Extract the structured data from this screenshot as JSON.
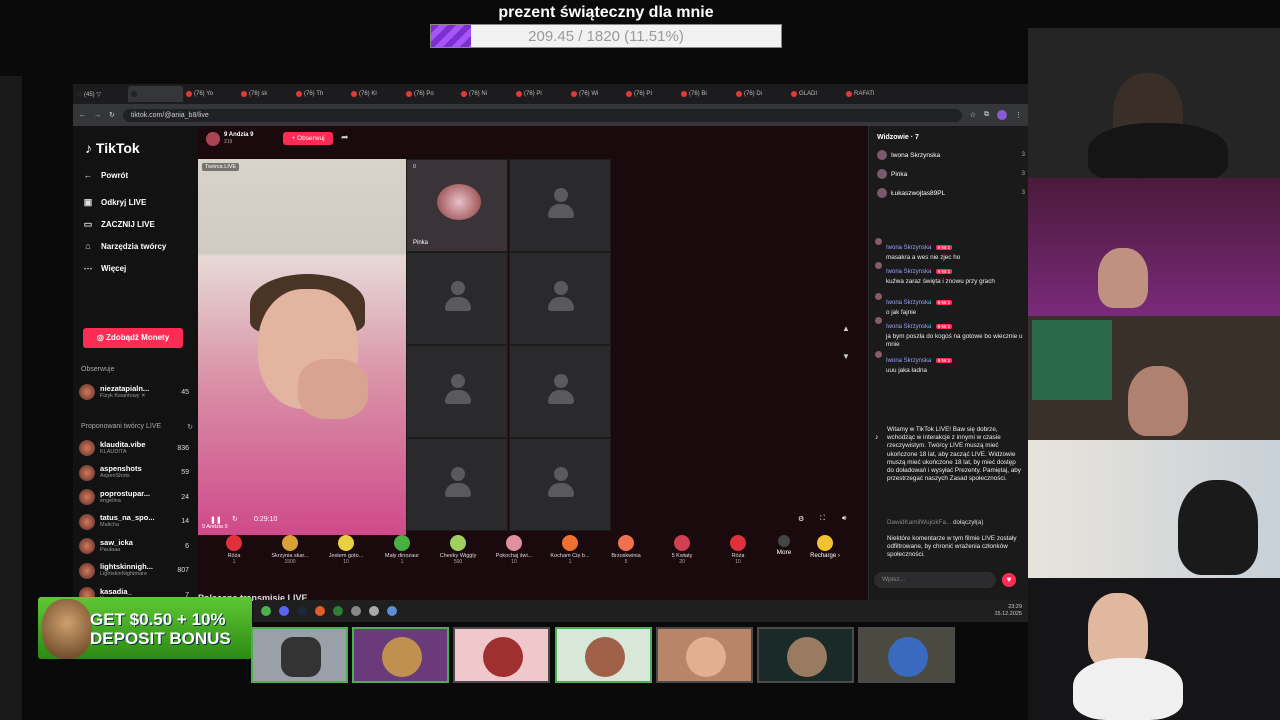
{
  "goal": {
    "title": "prezent świąteczny dla mnie",
    "progress_text": "209.45 / 1820 (11.51%)",
    "progress_fraction": 0.1151
  },
  "browser": {
    "tabs": [
      "(45) ▽",
      "",
      "(76) Yo",
      "(76) sk",
      "(76) Th",
      "(76) Kl",
      "(76) Po",
      "(76) Ni",
      "(76) Pl",
      "(76) Wi",
      "(76) PI",
      "(76) Bi",
      "(76) Di",
      "GLADI",
      "RAFATI"
    ],
    "url": "tiktok.com/@ania_b8/live"
  },
  "tiktok": {
    "logo": "TikTok",
    "nav": [
      "Powrót",
      "Odkryj LIVE",
      "ZACZNIJ LIVE",
      "Narzędzia twórcy",
      "Więcej"
    ],
    "coins_button": "Zdobądź Monety",
    "following_title": "Obserwuje",
    "following": [
      {
        "name": "niezatapialn...",
        "sub": "Fizyk Kwantowy ✕",
        "count": "45"
      }
    ],
    "suggested_title": "Proponowani twórcy LIVE",
    "suggested": [
      {
        "name": "klaudita.vibe",
        "sub": "KLAUDITA",
        "count": "836"
      },
      {
        "name": "aspenshots",
        "sub": "AspenShots",
        "count": "59"
      },
      {
        "name": "poprostupar...",
        "sub": "engelina",
        "count": "24"
      },
      {
        "name": "tatus_na_spo...",
        "sub": "Malicha",
        "count": "14"
      },
      {
        "name": "saw_icka",
        "sub": "Paulaaa",
        "count": "6"
      },
      {
        "name": "lightskinnigh...",
        "sub": "LightskinNightmare",
        "count": "807"
      },
      {
        "name": "kasadia_",
        "sub": "Kasadia",
        "count": "7"
      },
      {
        "name": "plinkmia",
        "sub": "Mia",
        "count": "357"
      },
      {
        "name": "strzalaxgami...",
        "sub": "",
        "count": ""
      }
    ],
    "host": {
      "name": "9 Andzia 9",
      "views": "219",
      "follow_label": "+ Obserwuj"
    },
    "cam_label": "Twórca LIVE",
    "cam_bottom": "9 Andzia 9",
    "guest": {
      "name": "Pinka",
      "count": "0"
    },
    "timer": "0:29:10",
    "gifts": [
      {
        "name": "Róża",
        "price": "1",
        "color": "#e0303a"
      },
      {
        "name": "Skrzynia skar...",
        "price": "1500",
        "color": "#d9a03a"
      },
      {
        "name": "Jestem goto...",
        "price": "10",
        "color": "#e8d040"
      },
      {
        "name": "Mały dinozaur",
        "price": "1",
        "color": "#48b040"
      },
      {
        "name": "Cheeky Wiggly",
        "price": "500",
        "color": "#a0d060"
      },
      {
        "name": "Pokochaj świ...",
        "price": "10",
        "color": "#e090a0"
      },
      {
        "name": "Kocham Cię b...",
        "price": "1",
        "color": "#f07030"
      },
      {
        "name": "Brzoskwinia",
        "price": "5",
        "color": "#f07050"
      },
      {
        "name": "5 Kwiaty",
        "price": "20",
        "color": "#d04050"
      },
      {
        "name": "Róża",
        "price": "10",
        "color": "#e0303a"
      }
    ],
    "more_label": "More",
    "recharge_label": "Recharge ›",
    "lower_title": "Polecane transmisje LIVE"
  },
  "chat": {
    "viewers_title": "Widzowie · 7",
    "viewers": [
      {
        "name": "Iwona Skrzynska",
        "rank": "3"
      },
      {
        "name": "Pinka",
        "rank": "3"
      },
      {
        "name": "Łukaszwojtas89PL",
        "rank": "3"
      }
    ],
    "messages": [
      {
        "user": "Iwona Skrzynska",
        "badge": "9 Nr 1",
        "text": "masakra a wes nie zjec ho"
      },
      {
        "user": "Iwona Skrzynska",
        "badge": "9 Nr 1",
        "text": "kuźwa zaraz święta i znowu przy grach"
      },
      {
        "user": "Iwona Skrzynska",
        "badge": "9 Nr 1",
        "text": "o jak fajnie"
      },
      {
        "user": "Iwona Skrzynska",
        "badge": "9 Nr 1",
        "text": "ja bym poszła do kogoś na gotowe bo wiecznie u mnie"
      },
      {
        "user": "Iwona Skrzynska",
        "badge": "9 Nr 1",
        "text": "uuu jaka ładna"
      }
    ],
    "system_message": "Witamy w TikTok LIVE! Baw się dobrze, wchodząc w interakcje z innymi w czasie rzeczywistym. Twórcy LIVE muszą mieć ukończone 18 lat, aby zacząć LIVE. Widzowie muszą mieć ukończone 18 lat, by mieć dostęp do doładowań i wysyłać Prezenty. Pamiętaj, aby przestrzegać naszych Zasad społeczności.",
    "joined_user": "DawidKamilWujcikFa...",
    "joined_text": "dołączył(a)",
    "filtered_note": "Niektóre komentarze w tym filmie LIVE zostały odfiltrowane, by chronić wrażenia członków społeczności.",
    "input_placeholder": "Wpisz..."
  },
  "taskbar": {
    "time": "23:29",
    "date": "15.12.2025"
  },
  "bonus": {
    "line1": "GET $0.50 + 10%",
    "line2": "DEPOSIT BONUS"
  }
}
